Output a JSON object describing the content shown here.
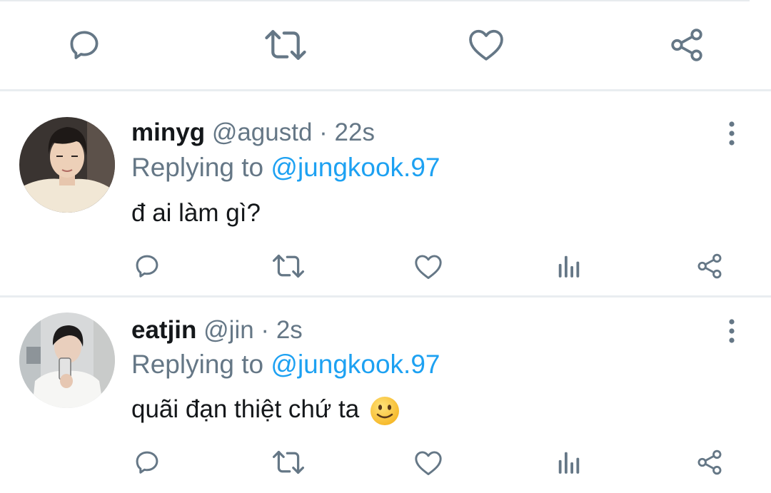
{
  "top_actions": {
    "icons": [
      "comment-icon",
      "retweet-icon",
      "like-icon",
      "share-icon"
    ]
  },
  "tweets": [
    {
      "name": "minyg",
      "handle": "@agustd",
      "separator": " · ",
      "time": "22s",
      "replying_prefix": "Replying to ",
      "replying_to": "@jungkook.97",
      "text": "đ ai làm gì?",
      "actions": [
        "comment-icon",
        "retweet-icon",
        "like-icon",
        "analytics-icon",
        "share-icon"
      ]
    },
    {
      "name": "eatjin",
      "handle": "@jin",
      "separator": " · ",
      "time": "2s",
      "replying_prefix": "Replying to ",
      "replying_to": "@jungkook.97",
      "text": "quãi đạn thiệt chứ ta",
      "emoji": "slightly-smiling-face-emoji",
      "actions": [
        "comment-icon",
        "retweet-icon",
        "like-icon",
        "analytics-icon",
        "share-icon"
      ]
    }
  ],
  "colors": {
    "icon": "#657786",
    "text": "#14171a",
    "secondary": "#657786",
    "link": "#1da1f2",
    "divider": "#e9edf0"
  }
}
